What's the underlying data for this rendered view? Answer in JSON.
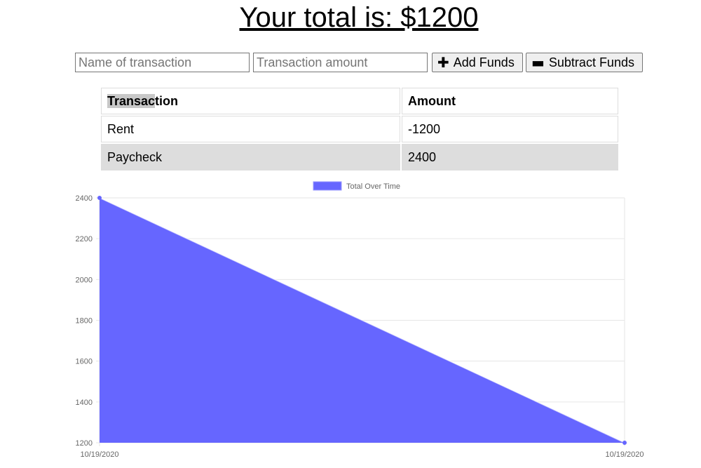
{
  "header": {
    "title": "Your total is: $1200"
  },
  "form": {
    "name_placeholder": "Name of transaction",
    "amount_placeholder": "Transaction amount",
    "add_label": "Add Funds",
    "add_icon": "plus-icon",
    "subtract_label": "Subtract Funds",
    "subtract_icon": "minus-icon"
  },
  "table": {
    "headers": [
      "Transaction",
      "Amount"
    ],
    "rows": [
      {
        "name": "Rent",
        "amount": "-1200"
      },
      {
        "name": "Paycheck",
        "amount": "2400"
      }
    ]
  },
  "chart_data": {
    "type": "area",
    "x": [
      "10/19/2020",
      "10/19/2020"
    ],
    "series": [
      {
        "name": "Total Over Time",
        "values": [
          2400,
          1200
        ],
        "color": "#6666ff"
      }
    ],
    "yticks": [
      1200,
      1400,
      1600,
      1800,
      2000,
      2200,
      2400
    ],
    "ylim": [
      1200,
      2400
    ],
    "grid": true,
    "legend": "top-center"
  }
}
